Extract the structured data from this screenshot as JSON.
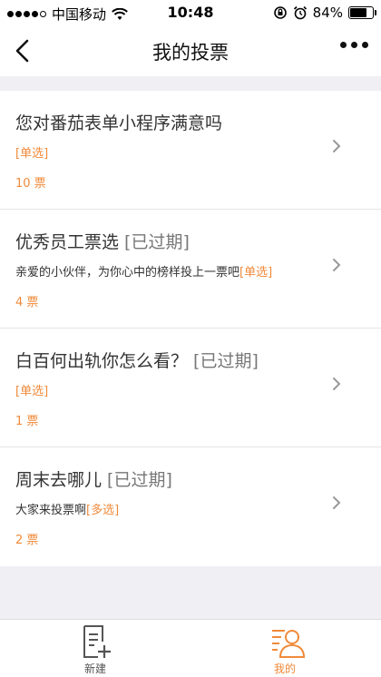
{
  "status_bar": {
    "carrier": "中国移动",
    "time": "10:48",
    "battery": "84%",
    "battery_level": 0.84
  },
  "nav": {
    "title": "我的投票",
    "back_icon": "chevron-left-icon",
    "more_icon": "more-dots-icon"
  },
  "polls": [
    {
      "title": "您对番茄表单小程序满意吗",
      "status": "",
      "description": "",
      "type_tag": "[单选]",
      "votes": "10 票"
    },
    {
      "title": "优秀员工票选 ",
      "status": "[已过期]",
      "description": "亲爱的小伙伴，为你心中的榜样投上一票吧",
      "type_tag": "[单选]",
      "votes": "4 票"
    },
    {
      "title": "白百何出轨你怎么看？ ",
      "status": "[已过期]",
      "description": "",
      "type_tag": "[单选]",
      "votes": "1 票"
    },
    {
      "title": "周末去哪儿 ",
      "status": "[已过期]",
      "description": "大家来投票啊",
      "type_tag": "[多选]",
      "votes": "2 票"
    }
  ],
  "tab_bar": {
    "new_label": "新建",
    "mine_label": "我的",
    "accent_color": "#f08a3a"
  }
}
